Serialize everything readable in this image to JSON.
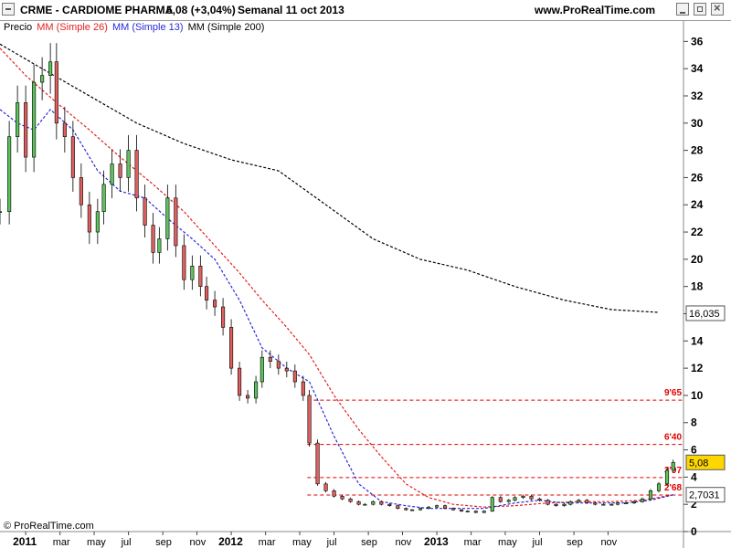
{
  "header": {
    "symbol_line": "CRME - CARDIOME PHARMA",
    "price_change": "5,08 (+3,04%)",
    "period_date": "Semanal  11 oct 2013",
    "site": "www.ProRealTime.com"
  },
  "legend": {
    "price": "Precio",
    "ma26": "MM (Simple 26)",
    "ma13": "MM (Simple 13)",
    "ma200": "MM (Simple 200)"
  },
  "copyright": "© ProRealTime.com",
  "colors": {
    "ma26": "#e32020",
    "ma13": "#2a2ad8",
    "ma200": "#000000",
    "bull": "#5cc45c",
    "bear": "#e06060",
    "level": "#e00000",
    "highlight": "#ffd700"
  },
  "chart_data": {
    "type": "candlestick",
    "title": "CRME - CARDIOME PHARMA",
    "ylim": [
      0,
      37.5
    ],
    "y_ticks": [
      "0",
      "2",
      "4",
      "6",
      "8",
      "10",
      "12",
      "14",
      "16",
      "18",
      "20",
      "22",
      "24",
      "26",
      "28",
      "30",
      "32",
      "34",
      "36"
    ],
    "x_ticks": [
      {
        "label": "2011",
        "date": 2011.0,
        "year": true
      },
      {
        "label": "mar",
        "date": 2011.167
      },
      {
        "label": "may",
        "date": 2011.333
      },
      {
        "label": "jul",
        "date": 2011.5
      },
      {
        "label": "sep",
        "date": 2011.667
      },
      {
        "label": "nov",
        "date": 2011.833
      },
      {
        "label": "2012",
        "date": 2012.0,
        "year": true
      },
      {
        "label": "mar",
        "date": 2012.167
      },
      {
        "label": "may",
        "date": 2012.333
      },
      {
        "label": "jul",
        "date": 2012.5
      },
      {
        "label": "sep",
        "date": 2012.667
      },
      {
        "label": "nov",
        "date": 2012.833
      },
      {
        "label": "2013",
        "date": 2013.0,
        "year": true
      },
      {
        "label": "mar",
        "date": 2013.167
      },
      {
        "label": "may",
        "date": 2013.333
      },
      {
        "label": "jul",
        "date": 2013.5
      },
      {
        "label": "sep",
        "date": 2013.667
      },
      {
        "label": "nov",
        "date": 2013.833
      }
    ],
    "price_series": {
      "name": "Precio",
      "points": [
        [
          2010.875,
          23.5
        ],
        [
          2010.92,
          29.0
        ],
        [
          2010.96,
          31.5
        ],
        [
          2011.0,
          27.5
        ],
        [
          2011.04,
          33.0
        ],
        [
          2011.08,
          33.5
        ],
        [
          2011.12,
          34.5
        ],
        [
          2011.15,
          30.0
        ],
        [
          2011.19,
          29.0
        ],
        [
          2011.23,
          26.0
        ],
        [
          2011.27,
          24.0
        ],
        [
          2011.31,
          22.0
        ],
        [
          2011.35,
          23.5
        ],
        [
          2011.38,
          25.5
        ],
        [
          2011.42,
          27.0
        ],
        [
          2011.46,
          26.0
        ],
        [
          2011.5,
          28.0
        ],
        [
          2011.54,
          24.5
        ],
        [
          2011.58,
          22.5
        ],
        [
          2011.62,
          20.5
        ],
        [
          2011.65,
          21.5
        ],
        [
          2011.69,
          24.5
        ],
        [
          2011.73,
          21.0
        ],
        [
          2011.77,
          18.5
        ],
        [
          2011.81,
          19.5
        ],
        [
          2011.85,
          18.0
        ],
        [
          2011.88,
          17.0
        ],
        [
          2011.92,
          16.5
        ],
        [
          2011.96,
          15.0
        ],
        [
          2012.0,
          12.0
        ],
        [
          2012.04,
          10.0
        ],
        [
          2012.08,
          9.8
        ],
        [
          2012.12,
          11.0
        ],
        [
          2012.15,
          12.8
        ],
        [
          2012.19,
          12.5
        ],
        [
          2012.23,
          12.0
        ],
        [
          2012.27,
          11.8
        ],
        [
          2012.31,
          11.0
        ],
        [
          2012.35,
          10.0
        ],
        [
          2012.38,
          6.5
        ],
        [
          2012.42,
          3.5
        ],
        [
          2012.46,
          3.0
        ],
        [
          2012.5,
          2.6
        ],
        [
          2012.54,
          2.4
        ],
        [
          2012.58,
          2.2
        ],
        [
          2012.62,
          2.0
        ],
        [
          2012.65,
          2.0
        ],
        [
          2012.69,
          2.2
        ],
        [
          2012.73,
          2.0
        ],
        [
          2012.77,
          1.9
        ],
        [
          2012.81,
          1.7
        ],
        [
          2012.85,
          1.6
        ],
        [
          2012.88,
          1.6
        ],
        [
          2012.92,
          1.7
        ],
        [
          2012.96,
          1.8
        ],
        [
          2013.0,
          1.9
        ],
        [
          2013.04,
          1.7
        ],
        [
          2013.08,
          1.6
        ],
        [
          2013.12,
          1.5
        ],
        [
          2013.15,
          1.5
        ],
        [
          2013.19,
          1.4
        ],
        [
          2013.23,
          1.5
        ],
        [
          2013.27,
          2.5
        ],
        [
          2013.31,
          2.2
        ],
        [
          2013.35,
          2.3
        ],
        [
          2013.38,
          2.5
        ],
        [
          2013.42,
          2.6
        ],
        [
          2013.46,
          2.4
        ],
        [
          2013.5,
          2.3
        ],
        [
          2013.54,
          2.0
        ],
        [
          2013.58,
          1.9
        ],
        [
          2013.62,
          2.0
        ],
        [
          2013.65,
          2.2
        ],
        [
          2013.69,
          2.3
        ],
        [
          2013.73,
          2.1
        ],
        [
          2013.77,
          2.0
        ],
        [
          2013.81,
          2.0
        ],
        [
          2013.85,
          2.0
        ],
        [
          2013.88,
          2.1
        ],
        [
          2013.92,
          2.1
        ],
        [
          2013.96,
          2.2
        ],
        [
          2014.0,
          2.4
        ],
        [
          2014.04,
          3.0
        ],
        [
          2014.08,
          3.5
        ],
        [
          2014.12,
          4.5
        ],
        [
          2014.15,
          5.08
        ]
      ]
    },
    "series": [
      {
        "name": "MM (Simple 26)",
        "points": [
          [
            2010.875,
            35.5
          ],
          [
            2011.0,
            33.5
          ],
          [
            2011.15,
            31.5
          ],
          [
            2011.31,
            29.5
          ],
          [
            2011.46,
            27.5
          ],
          [
            2011.62,
            25.5
          ],
          [
            2011.77,
            23.5
          ],
          [
            2011.92,
            21.0
          ],
          [
            2012.04,
            19.0
          ],
          [
            2012.15,
            17.0
          ],
          [
            2012.27,
            15.0
          ],
          [
            2012.38,
            13.0
          ],
          [
            2012.5,
            10.0
          ],
          [
            2012.62,
            7.5
          ],
          [
            2012.73,
            5.5
          ],
          [
            2012.85,
            3.5
          ],
          [
            2012.96,
            2.5
          ],
          [
            2013.08,
            2.0
          ],
          [
            2013.23,
            1.8
          ],
          [
            2013.38,
            1.9
          ],
          [
            2013.54,
            2.1
          ],
          [
            2013.69,
            2.2
          ],
          [
            2013.85,
            2.2
          ],
          [
            2014.0,
            2.3
          ],
          [
            2014.15,
            2.7
          ]
        ]
      },
      {
        "name": "MM (Simple 13)",
        "points": [
          [
            2010.875,
            31.0
          ],
          [
            2010.96,
            30.0
          ],
          [
            2011.04,
            29.5
          ],
          [
            2011.12,
            31.0
          ],
          [
            2011.23,
            29.5
          ],
          [
            2011.35,
            26.5
          ],
          [
            2011.46,
            25.0
          ],
          [
            2011.58,
            24.5
          ],
          [
            2011.69,
            23.0
          ],
          [
            2011.81,
            21.5
          ],
          [
            2011.92,
            20.0
          ],
          [
            2012.04,
            17.0
          ],
          [
            2012.15,
            13.5
          ],
          [
            2012.27,
            12.0
          ],
          [
            2012.38,
            11.0
          ],
          [
            2012.5,
            7.0
          ],
          [
            2012.62,
            3.5
          ],
          [
            2012.73,
            2.2
          ],
          [
            2012.85,
            1.9
          ],
          [
            2012.96,
            1.7
          ],
          [
            2013.08,
            1.7
          ],
          [
            2013.23,
            1.7
          ],
          [
            2013.38,
            2.1
          ],
          [
            2013.5,
            2.3
          ],
          [
            2013.62,
            2.1
          ],
          [
            2013.77,
            2.1
          ],
          [
            2013.92,
            2.1
          ],
          [
            2014.04,
            2.3
          ],
          [
            2014.15,
            2.7
          ]
        ]
      },
      {
        "name": "MM (Simple 200)",
        "points": [
          [
            2010.875,
            35.8
          ],
          [
            2011.08,
            34.0
          ],
          [
            2011.31,
            32.0
          ],
          [
            2011.54,
            30.0
          ],
          [
            2011.77,
            28.5
          ],
          [
            2012.0,
            27.3
          ],
          [
            2012.23,
            26.5
          ],
          [
            2012.46,
            24.0
          ],
          [
            2012.69,
            21.5
          ],
          [
            2012.92,
            20.0
          ],
          [
            2013.15,
            19.2
          ],
          [
            2013.38,
            18.0
          ],
          [
            2013.62,
            17.0
          ],
          [
            2013.85,
            16.3
          ],
          [
            2014.08,
            16.1
          ]
        ]
      }
    ],
    "levels": [
      {
        "label": "9'65",
        "value": 9.65
      },
      {
        "label": "6'40",
        "value": 6.4
      },
      {
        "label": "3'97",
        "value": 3.97
      },
      {
        "label": "2'68",
        "value": 2.68
      }
    ],
    "last_value_labels": [
      {
        "label": "16,035",
        "value": 16.035,
        "highlight": false
      },
      {
        "label": "5,08",
        "value": 5.08,
        "highlight": true
      },
      {
        "label": "2,7031",
        "value": 2.7031,
        "highlight": false
      }
    ]
  }
}
